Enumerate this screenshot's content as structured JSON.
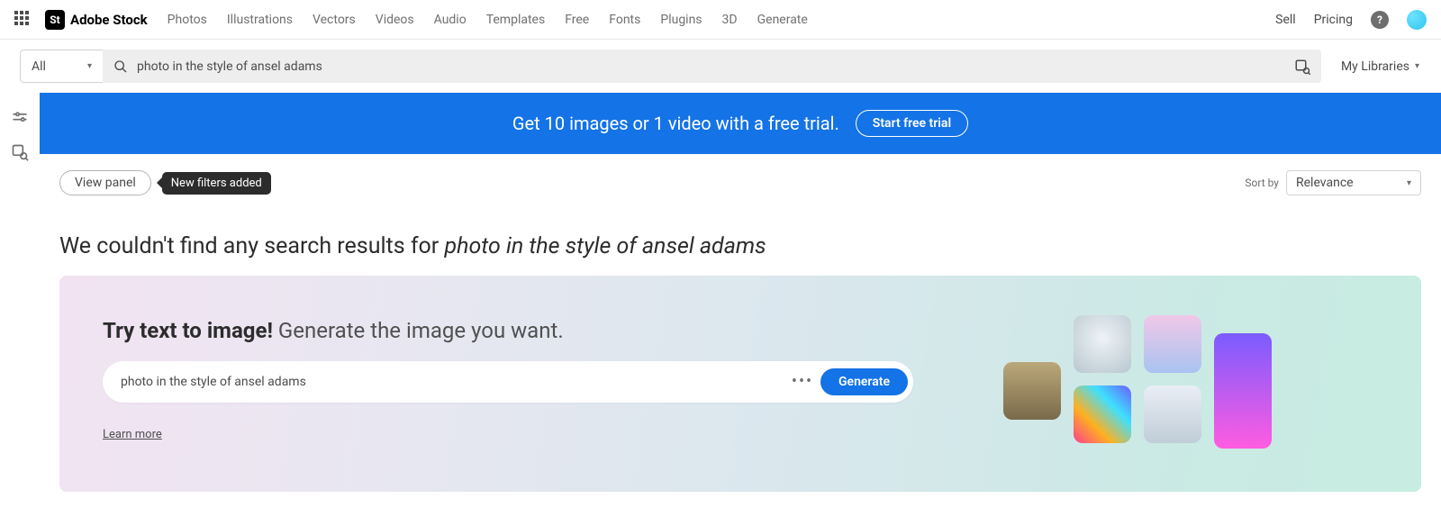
{
  "header": {
    "brand": "Adobe Stock",
    "logo_initials": "St",
    "nav": [
      "Photos",
      "Illustrations",
      "Vectors",
      "Videos",
      "Audio",
      "Templates",
      "Free",
      "Fonts",
      "Plugins",
      "3D",
      "Generate"
    ],
    "sell": "Sell",
    "pricing": "Pricing"
  },
  "search": {
    "category": "All",
    "query": "photo in the style of ansel adams",
    "my_libraries": "My Libraries"
  },
  "promo": {
    "text": "Get 10 images or 1 video with a free trial.",
    "cta": "Start free trial"
  },
  "toolbar": {
    "view_panel": "View panel",
    "filters_badge": "New filters added",
    "sort_label": "Sort by",
    "sort_value": "Relevance"
  },
  "no_results": {
    "prefix": "We couldn't find any search results for ",
    "query": "photo in the style of ansel adams"
  },
  "tti": {
    "heading_bold": "Try text to image!",
    "heading_rest": " Generate the image you want.",
    "input_value": "photo in the style of ansel adams",
    "generate": "Generate",
    "learn_more": "Learn more"
  }
}
